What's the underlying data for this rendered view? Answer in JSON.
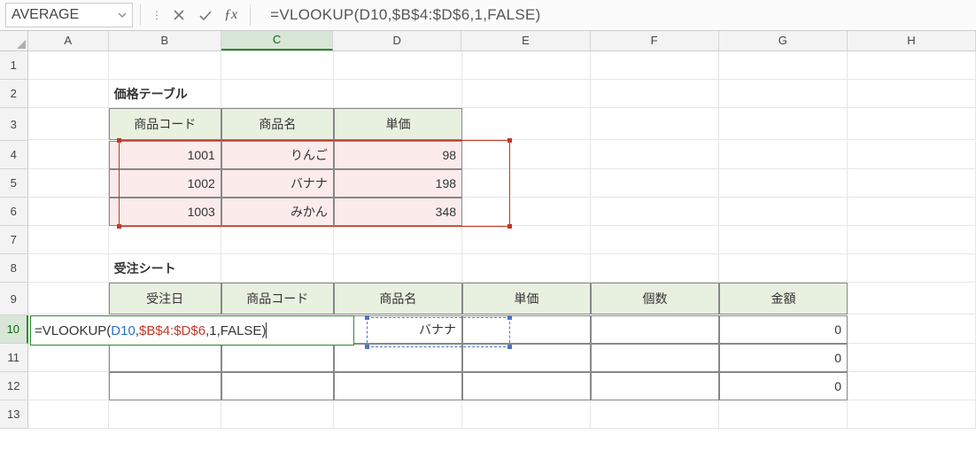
{
  "nameBox": "AVERAGE",
  "formula": "=VLOOKUP(D10,$B$4:$D$6,1,FALSE)",
  "colHeaders": [
    "A",
    "B",
    "C",
    "D",
    "E",
    "F",
    "G",
    "H"
  ],
  "rowHeaders": [
    "1",
    "2",
    "3",
    "4",
    "5",
    "6",
    "7",
    "8",
    "9",
    "10",
    "11",
    "12",
    "13"
  ],
  "priceTable": {
    "title": "価格テーブル",
    "headers": [
      "商品コード",
      "商品名",
      "単価"
    ],
    "rows": [
      {
        "code": "1001",
        "name": "りんご",
        "price": "98"
      },
      {
        "code": "1002",
        "name": "バナナ",
        "price": "198"
      },
      {
        "code": "1003",
        "name": "みかん",
        "price": "348"
      }
    ]
  },
  "orderSheet": {
    "title": "受注シート",
    "headers": [
      "受注日",
      "商品コード",
      "商品名",
      "単価",
      "個数",
      "金額"
    ],
    "rows": [
      {
        "name": "バナナ",
        "amount": "0"
      },
      {
        "amount": "0"
      },
      {
        "amount": "0"
      }
    ]
  },
  "editFormula": {
    "eq": "=",
    "fn": "VLOOKUP(",
    "ref": "D10",
    "c1": ",",
    "rng": "$B$4:$D$6",
    "c2": ",",
    "a1": "1",
    "c3": ",",
    "a2": "FALSE",
    "close": ")"
  }
}
